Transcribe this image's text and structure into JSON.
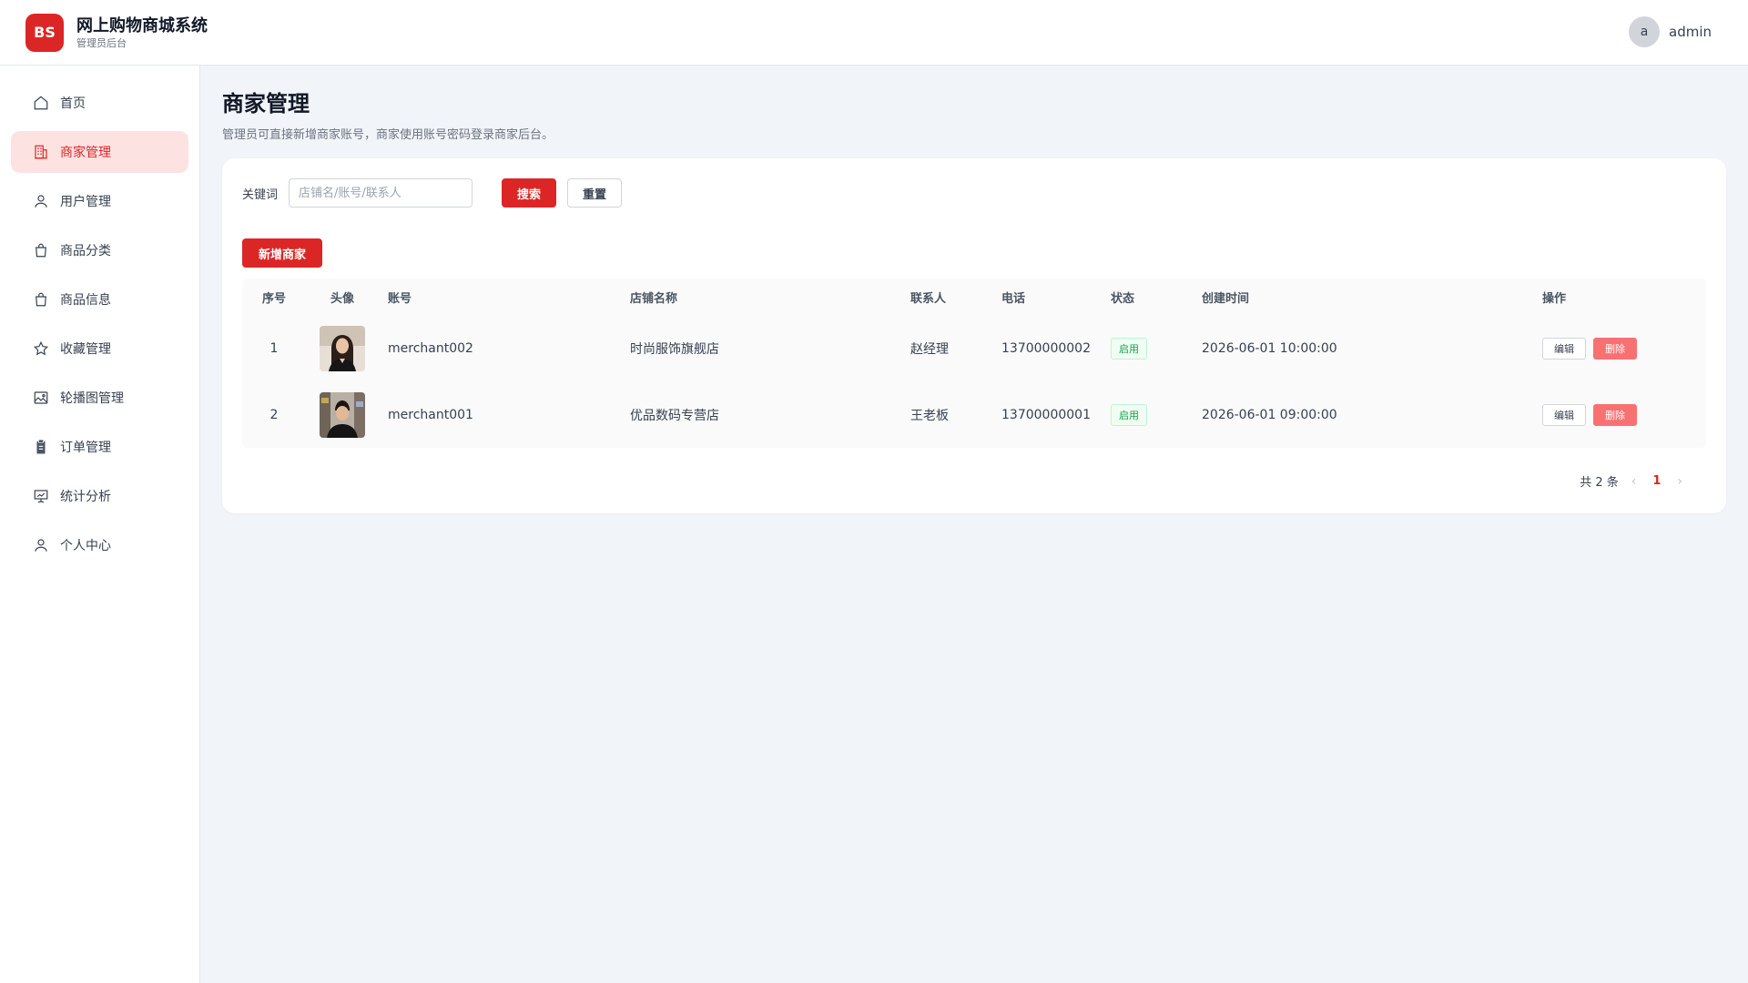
{
  "app": {
    "logo_text": "BS",
    "title": "网上购物商城系统",
    "subtitle": "管理员后台",
    "brand_color": "#dc2626"
  },
  "user": {
    "avatar_letter": "a",
    "name": "admin"
  },
  "sidebar": {
    "items": [
      {
        "label": "首页",
        "icon": "home-icon",
        "active": false
      },
      {
        "label": "商家管理",
        "icon": "building-icon",
        "active": true
      },
      {
        "label": "用户管理",
        "icon": "user-icon",
        "active": false
      },
      {
        "label": "商品分类",
        "icon": "shopping-bag-icon",
        "active": false
      },
      {
        "label": "商品信息",
        "icon": "shopping-bag-icon",
        "active": false
      },
      {
        "label": "收藏管理",
        "icon": "star-icon",
        "active": false
      },
      {
        "label": "轮播图管理",
        "icon": "image-icon",
        "active": false
      },
      {
        "label": "订单管理",
        "icon": "clipboard-icon",
        "active": false
      },
      {
        "label": "统计分析",
        "icon": "presentation-chart-icon",
        "active": false
      },
      {
        "label": "个人中心",
        "icon": "user-icon",
        "active": false
      }
    ]
  },
  "page": {
    "title": "商家管理",
    "description": "管理员可直接新增商家账号，商家使用账号密码登录商家后台。"
  },
  "search": {
    "label": "关键词",
    "placeholder": "店铺名/账号/联系人",
    "value": "",
    "search_label": "搜索",
    "reset_label": "重置"
  },
  "actions": {
    "add_label": "新增商家"
  },
  "table": {
    "columns": [
      "序号",
      "头像",
      "账号",
      "店铺名称",
      "联系人",
      "电话",
      "状态",
      "创建时间",
      "操作"
    ],
    "rows": [
      {
        "index": "1",
        "avatar": "female-merchant-photo",
        "account": "merchant002",
        "shop": "时尚服饰旗舰店",
        "contact": "赵经理",
        "phone": "13700000002",
        "status": "启用",
        "created": "2026-06-01 10:00:00",
        "edit": "编辑",
        "delete": "删除"
      },
      {
        "index": "2",
        "avatar": "male-merchant-photo",
        "account": "merchant001",
        "shop": "优品数码专营店",
        "contact": "王老板",
        "phone": "13700000001",
        "status": "启用",
        "created": "2026-06-01 09:00:00",
        "edit": "编辑",
        "delete": "删除"
      }
    ]
  },
  "pagination": {
    "total_text": "共 2 条",
    "current_page": "1",
    "prev_icon": "chevron-left-icon",
    "next_icon": "chevron-right-icon"
  }
}
